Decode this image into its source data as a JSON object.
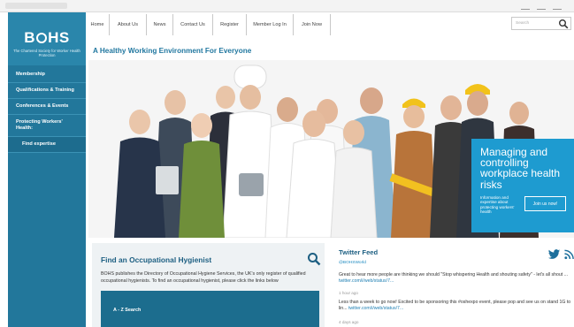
{
  "site": {
    "logo_text": "B  HS",
    "logo_tagline": "The Chartered Society for Worker Health Protection",
    "tagline": "A Healthy Working Environment For Everyone"
  },
  "top_nav": [
    {
      "label": "Home"
    },
    {
      "label": "About Us"
    },
    {
      "label": "News"
    },
    {
      "label": "Contact Us"
    },
    {
      "label": "Register"
    },
    {
      "label": "Member Log In"
    },
    {
      "label": "Join Now"
    }
  ],
  "search": {
    "placeholder": "Search"
  },
  "sidebar": {
    "items": [
      {
        "label": "Membership"
      },
      {
        "label": "Qualifications & Training"
      },
      {
        "label": "Conferences & Events"
      },
      {
        "label": "Protecting Workers' Health:"
      },
      {
        "label": "Find expertise"
      }
    ]
  },
  "promo": {
    "title": "Managing and controlling workplace health risks",
    "subtitle": "Information and expertise about protecting workers' health",
    "button": "Join us now!"
  },
  "find_hygienist": {
    "title": "Find an Occupational Hygienist",
    "text": "BOHS publishes the Directory of Occupational Hygiene Services, the UK's only register of qualified occupational hygienists. To find an occupational hygienist, please click the links below",
    "az_label": "A - Z Search"
  },
  "twitter": {
    "title": "Twitter Feed",
    "handle": "@BOHSWorld",
    "tweets": [
      {
        "text": "Great to hear more people are thinking we should \"Stop whispering Health and shouting safety\" - let's all shout ...",
        "link": "twitter.com/i/web/status/7...",
        "time": "1 hour ago"
      },
      {
        "text": "Less than a week to go now! Excited to be sponsoring this #oshexpo event, please pop and see us on stand 1G to lin...",
        "link": "twitter.com/i/web/status/7...",
        "time": "4 days ago"
      }
    ]
  },
  "colors": {
    "sidebar": "#22779b",
    "accent": "#2278a0",
    "promo": "#1e9bd0",
    "az_bar": "#1c6d8e"
  }
}
